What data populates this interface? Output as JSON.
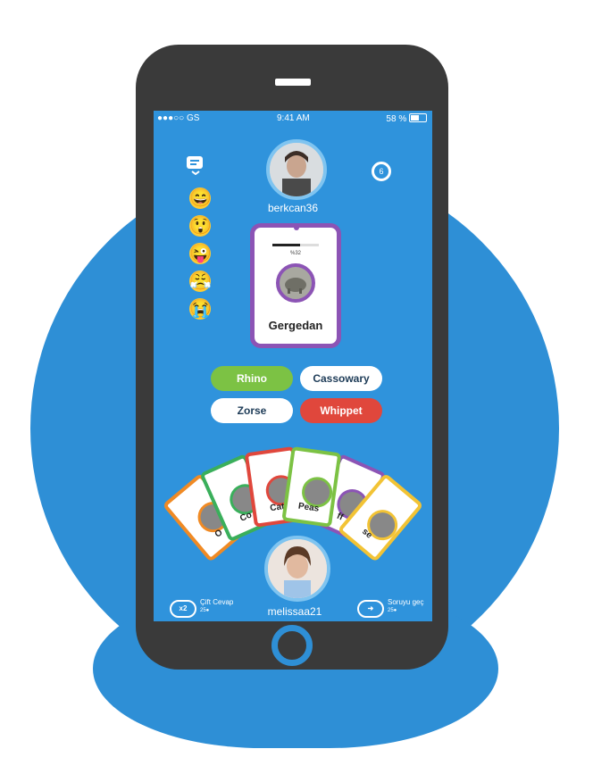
{
  "status_bar": {
    "carrier": "●●●○○ GS",
    "time": "9:41 AM",
    "battery": "58 %"
  },
  "opponent": {
    "username": "berkcan36"
  },
  "timer": {
    "value": "6"
  },
  "emojis": [
    "😄",
    "😲",
    "😜",
    "😤",
    "😭"
  ],
  "question_card": {
    "time_label": "%32",
    "word": "Gergedan",
    "progress_fraction": 0.6
  },
  "answers": [
    "Rhino",
    "Cassowary",
    "Zorse",
    "Whippet"
  ],
  "hand_cards": [
    {
      "label": "O",
      "color": "#f08a24"
    },
    {
      "label": "Co",
      "color": "#3aaf5b"
    },
    {
      "label": "Cat",
      "color": "#e0473c"
    },
    {
      "label": "Peas",
      "color": "#7cc244"
    },
    {
      "label": "ff",
      "color": "#8c54b5"
    },
    {
      "label": "se",
      "color": "#f2c335"
    }
  ],
  "player": {
    "username": "melissaa21"
  },
  "powerups": {
    "double": {
      "icon_text": "x2",
      "title": "Çift Cevap",
      "cost": "25●"
    },
    "skip": {
      "icon_text": "➜",
      "title": "Soruyu geç",
      "cost": "25●"
    }
  },
  "colors": {
    "screen_blue": "#2f93dc",
    "accent_purple": "#8c54b5",
    "correct_green": "#7cc244",
    "wrong_red": "#e0473c"
  }
}
